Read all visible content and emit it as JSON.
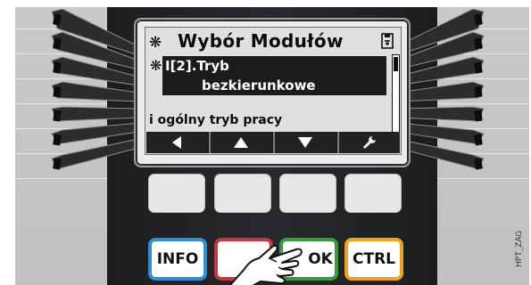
{
  "screen": {
    "title": "Wybór Modułów",
    "title_marker": "❋",
    "row_marker": "❋",
    "selected_param": "I[2].Tryb",
    "selected_value": "bezkierunkowe",
    "description": "i ogólny tryb pracy"
  },
  "softkeys": [
    {
      "name": "left",
      "icon": "triangle-left-icon"
    },
    {
      "name": "up",
      "icon": "triangle-up-icon"
    },
    {
      "name": "down",
      "icon": "triangle-down-icon"
    },
    {
      "name": "edit",
      "icon": "wrench-icon"
    }
  ],
  "buttons": {
    "info": "INFO",
    "ok": "OK",
    "ctrl": "CTRL"
  },
  "colors": {
    "info": "#2f8ed6",
    "back": "#c8353f",
    "ok": "#3a9b3c",
    "ctrl": "#f0a21f",
    "led": "#5bd64a"
  },
  "watermark": "HPT_ZAG"
}
